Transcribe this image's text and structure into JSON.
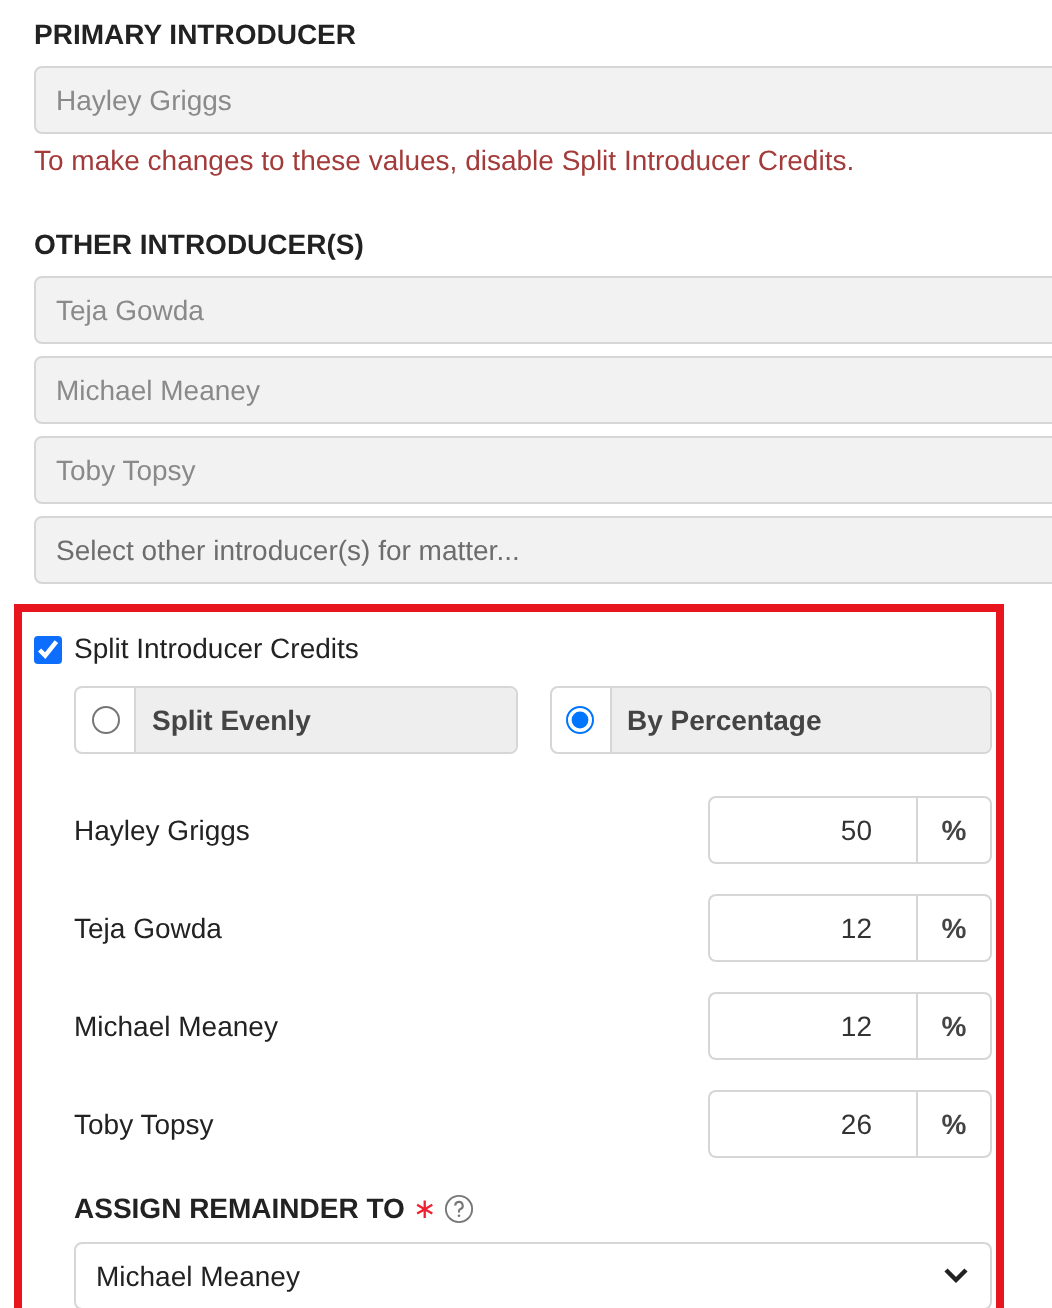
{
  "primary": {
    "label": "PRIMARY INTRODUCER",
    "value": "Hayley Griggs",
    "disabled": true,
    "note": "To make changes to these values, disable Split Introducer Credits."
  },
  "others": {
    "label": "OTHER INTRODUCER(S)",
    "values": [
      {
        "value": "Teja Gowda",
        "disabled": true
      },
      {
        "value": "Michael Meaney",
        "disabled": true
      },
      {
        "value": "Toby Topsy",
        "disabled": true
      }
    ],
    "placeholder": "Select other introducer(s) for matter..."
  },
  "split": {
    "label": "Split Introducer Credits",
    "checked": true,
    "options": [
      {
        "label": "Split Evenly",
        "selected": false
      },
      {
        "label": "By Percentage",
        "selected": true
      }
    ],
    "allocations": [
      {
        "name": "Hayley Griggs",
        "value": "50",
        "unit": "%"
      },
      {
        "name": "Teja Gowda",
        "value": "12",
        "unit": "%"
      },
      {
        "name": "Michael Meaney",
        "value": "12",
        "unit": "%"
      },
      {
        "name": "Toby Topsy",
        "value": "26",
        "unit": "%"
      }
    ],
    "remainder": {
      "label": "ASSIGN REMAINDER TO",
      "required_mark": "∗",
      "value": "Michael Meaney"
    }
  }
}
